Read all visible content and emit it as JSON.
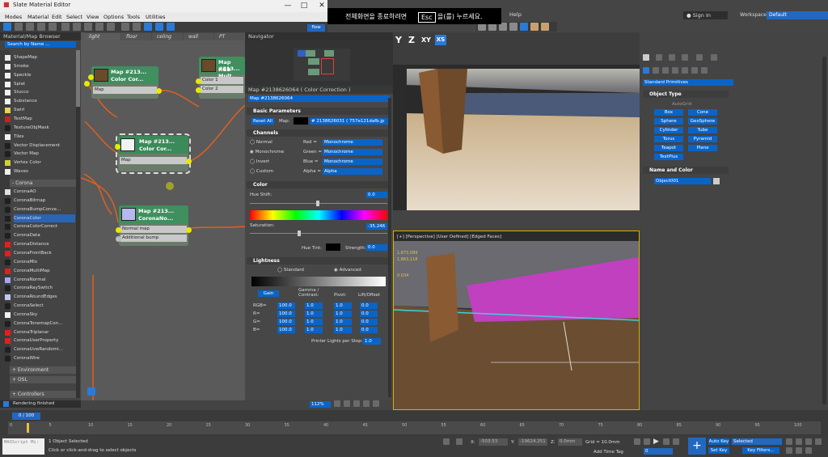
{
  "window": {
    "title": "Slate Material Editor",
    "min": "—",
    "max": "□",
    "close": "✕"
  },
  "menu": [
    "Modes",
    "Material",
    "Edit",
    "Select",
    "View",
    "Options",
    "Tools",
    "Utilities"
  ],
  "max_menu": {
    "help": "Help",
    "sign_in": "Sign In",
    "workspaces_label": "Workspaces:",
    "workspace": "Default",
    "flow": "flow"
  },
  "overlay": {
    "text_before": "전체화면을 종료하려면",
    "key": "Esc",
    "text_after": "을(를) 누르세요."
  },
  "axis_buttons": {
    "y": "Y",
    "z": "Z",
    "xy": "XY",
    "xs": "XS"
  },
  "browser": {
    "title": "Material/Map Browser",
    "search_placeholder": "Search by Name ...",
    "maps_a": [
      {
        "label": "ShapeMap",
        "color": "#e8e8e8"
      },
      {
        "label": "Smoke",
        "color": "#f0f0f0"
      },
      {
        "label": "Speckle",
        "color": "#f0f0f0"
      },
      {
        "label": "Splat",
        "color": "#f0f0f0"
      },
      {
        "label": "Stucco",
        "color": "#f0f0f0"
      },
      {
        "label": "Substance",
        "color": "#f0f0f0"
      },
      {
        "label": "Swirl",
        "color": "#e8d060"
      },
      {
        "label": "TextMap",
        "color": "#cc2020"
      },
      {
        "label": "TextureObjMask",
        "color": "#202020"
      },
      {
        "label": "Tiles",
        "color": "#f0f0f0"
      },
      {
        "label": "Vector Displacement",
        "color": "#202020"
      },
      {
        "label": "Vector Map",
        "color": "#202020"
      },
      {
        "label": "Vertex Color",
        "color": "#d0d030"
      },
      {
        "label": "Waves",
        "color": "#f0f0f0"
      }
    ],
    "corona_group": "- Corona",
    "maps_b": [
      {
        "label": "CoronaAO",
        "color": "#e0e0e0"
      },
      {
        "label": "CoronaBitmap",
        "color": "#202020"
      },
      {
        "label": "CoronaBumpConve...",
        "color": "#202020"
      },
      {
        "label": "CoronaColor",
        "color": "#202020",
        "selected": true
      },
      {
        "label": "CoronaColorCorrect",
        "color": "#202020"
      },
      {
        "label": "CoronaData",
        "color": "#202020"
      },
      {
        "label": "CoronaDistance",
        "color": "#e02020"
      },
      {
        "label": "CoronaFrontBack",
        "color": "#e02020"
      },
      {
        "label": "CoronaMix",
        "color": "#202020"
      },
      {
        "label": "CoronaMultiMap",
        "color": "#e02020"
      },
      {
        "label": "CoronaNormal",
        "color": "#a0a8f0"
      },
      {
        "label": "CoronaRaySwitch",
        "color": "#202020"
      },
      {
        "label": "CoronaRoundEdges",
        "color": "#c0c8f0"
      },
      {
        "label": "CoronaSelect",
        "color": "#202020"
      },
      {
        "label": "CoronaSky",
        "color": "#f0f0f0"
      },
      {
        "label": "CoronaTonemapCon...",
        "color": "#202020"
      },
      {
        "label": "CoronaTriplanar",
        "color": "#e02020"
      },
      {
        "label": "CoronaUserProperty",
        "color": "#e02020"
      },
      {
        "label": "CoronaUvwRandomi...",
        "color": "#202020"
      },
      {
        "label": "CoronaWire",
        "color": "#202020"
      }
    ],
    "groups_after": [
      "+ Environment",
      "+ OSL"
    ],
    "controllers": "+ Controllers"
  },
  "view_tabs": [
    "light",
    "floor",
    "celing",
    "wall",
    "PT"
  ],
  "nodes": {
    "n1": {
      "title1": "Map #213...",
      "title2": "Color Cor...",
      "rows": [
        "Map"
      ]
    },
    "n2": {
      "title1": "Map #213...",
      "title2": "RGB Mult...",
      "rows": [
        "Color 1",
        "Color 2"
      ]
    },
    "n3": {
      "title1": "Map #213...",
      "title2": "Color Cor...",
      "rows": [
        "Map"
      ]
    },
    "n4": {
      "title1": "Map #213...",
      "title2": "CoronaNo...",
      "rows": [
        "Normal map",
        "Additional bump"
      ]
    }
  },
  "navigator": {
    "title": "Navigator"
  },
  "params": {
    "header": "Map #2138626064  ( Color Correction )",
    "map_field": "Map #2138626064",
    "basic": "Basic Parameters",
    "reset": "Reset All",
    "map_label": "Map:",
    "map_value": "# 2138626031 ( 757e121dafb.jp",
    "channels": "Channels",
    "ch_modes": [
      "Normal",
      "Monochrome",
      "Invert",
      "Custom"
    ],
    "ch_labels": [
      "Red =",
      "Green =",
      "Blue =",
      "Alpha ="
    ],
    "ch_values": [
      "Monochrome",
      "Monochrome",
      "Monochrome",
      "Alpha"
    ],
    "color": "Color",
    "hue_shift": "Hue Shift:",
    "hue_value": "0.0",
    "saturation": "Saturation:",
    "sat_value": "-35.246",
    "hue_tint": "Hue Tint:",
    "strength": "Strength:",
    "strength_value": "0.0",
    "lightness": "Lightness",
    "standard": "Standard",
    "advanced": "Advanced",
    "gain": "Gain",
    "gamma": "Gamma / Contrast:",
    "pivot": "Pivot:",
    "lift": "Lift/Offset",
    "rows": [
      {
        "label": "RGB=",
        "a": "100.0",
        "b": "1.0",
        "c": "1.0",
        "d": "0.0"
      },
      {
        "label": "R=",
        "a": "100.0",
        "b": "1.0",
        "c": "1.0",
        "d": "0.0"
      },
      {
        "label": "G=",
        "a": "100.0",
        "b": "1.0",
        "c": "1.0",
        "d": "0.0"
      },
      {
        "label": "B=",
        "a": "100.0",
        "b": "1.0",
        "c": "1.0",
        "d": "0.0"
      }
    ],
    "printer": "Printer Lights per Stop:",
    "printer_value": "1.0",
    "zoom": "112%"
  },
  "viewport": {
    "label": "[+] [Perspective] [User Defined] [Edged Faces]",
    "stat1": "1,873,089",
    "stat2": "1,863,118",
    "fps": "0.034"
  },
  "cmd": {
    "dropdown": "Standard Primitives",
    "object_type": "Object Type",
    "autogrid": "AutoGrid",
    "buttons": [
      "Box",
      "Cone",
      "Sphere",
      "GeoSphere",
      "Cylinder",
      "Tube",
      "Torus",
      "Pyramid",
      "Teapot",
      "Plane",
      "TextPlus"
    ],
    "name_color": "Name and Color",
    "object_name": "Object001"
  },
  "timeline": {
    "frame": "0 / 100",
    "ticks": [
      "0",
      "5",
      "10",
      "15",
      "20",
      "25",
      "30",
      "35",
      "40",
      "45",
      "50",
      "55",
      "60",
      "65",
      "70",
      "75",
      "80",
      "85",
      "90",
      "95",
      "100"
    ]
  },
  "status": {
    "rendering": "Rendering finished",
    "maxscript": "MAXScript Mi:",
    "selected": "1 Object Selected",
    "hint": "Click or click-and-drag to select objects",
    "x": "-503.53",
    "y": "-19624.251",
    "z": "0.0mm",
    "grid": "Grid = 10.0mm",
    "add_time_tag": "Add Time Tag",
    "auto_key": "Auto Key",
    "set_key": "Set Key",
    "selected_dd": "Selected",
    "key_filters": "Key Filters...",
    "frame_field": "0"
  }
}
